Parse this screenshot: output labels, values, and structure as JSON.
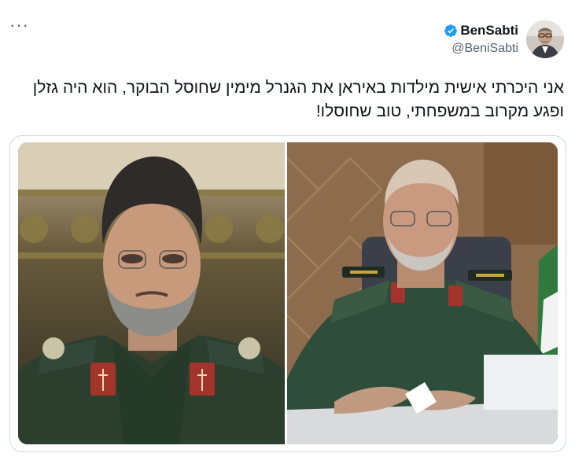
{
  "tweet": {
    "author": {
      "display_name": "BenSabti",
      "handle": "@BeniSabti",
      "verified": true,
      "verified_color": "#1d9bf0"
    },
    "more_label": "···",
    "text": "אני היכרתי אישית מילדות באיראן את הגנרל מימין שחוסל הבוקר, הוא היה גזלן ופגע מקרוב במשפחתי, טוב שחוסלו!",
    "media": {
      "images": [
        {
          "name": "general-left-photo",
          "icon": "photo"
        },
        {
          "name": "general-right-photo",
          "icon": "photo"
        }
      ]
    }
  },
  "colors": {
    "text": "#0f1419",
    "secondary": "#536471",
    "border": "#cfd9de",
    "uniform_green": "#2f4a35"
  }
}
